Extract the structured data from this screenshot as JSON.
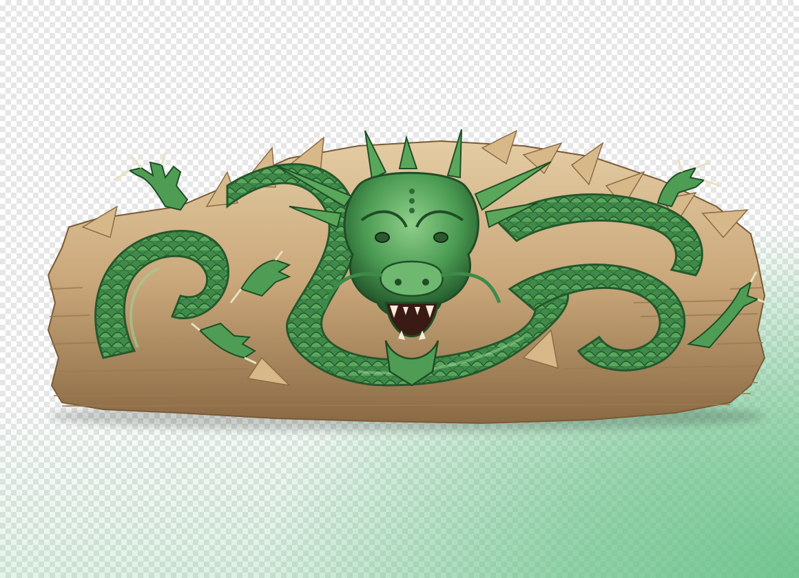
{
  "image": {
    "subject": "dragon-carving",
    "background": "transparency-checkerboard",
    "colors": {
      "checker_light": "#ffffff",
      "checker_dark": "#e6e6e6",
      "wash_green": "#60be82",
      "dragon_green": "#3f8a4a",
      "dragon_light": "#6fb870",
      "dragon_dark": "#24582c",
      "wood": "#c9a77a",
      "wood_dark": "#8a6a44",
      "wood_light": "#e4cca3"
    }
  }
}
